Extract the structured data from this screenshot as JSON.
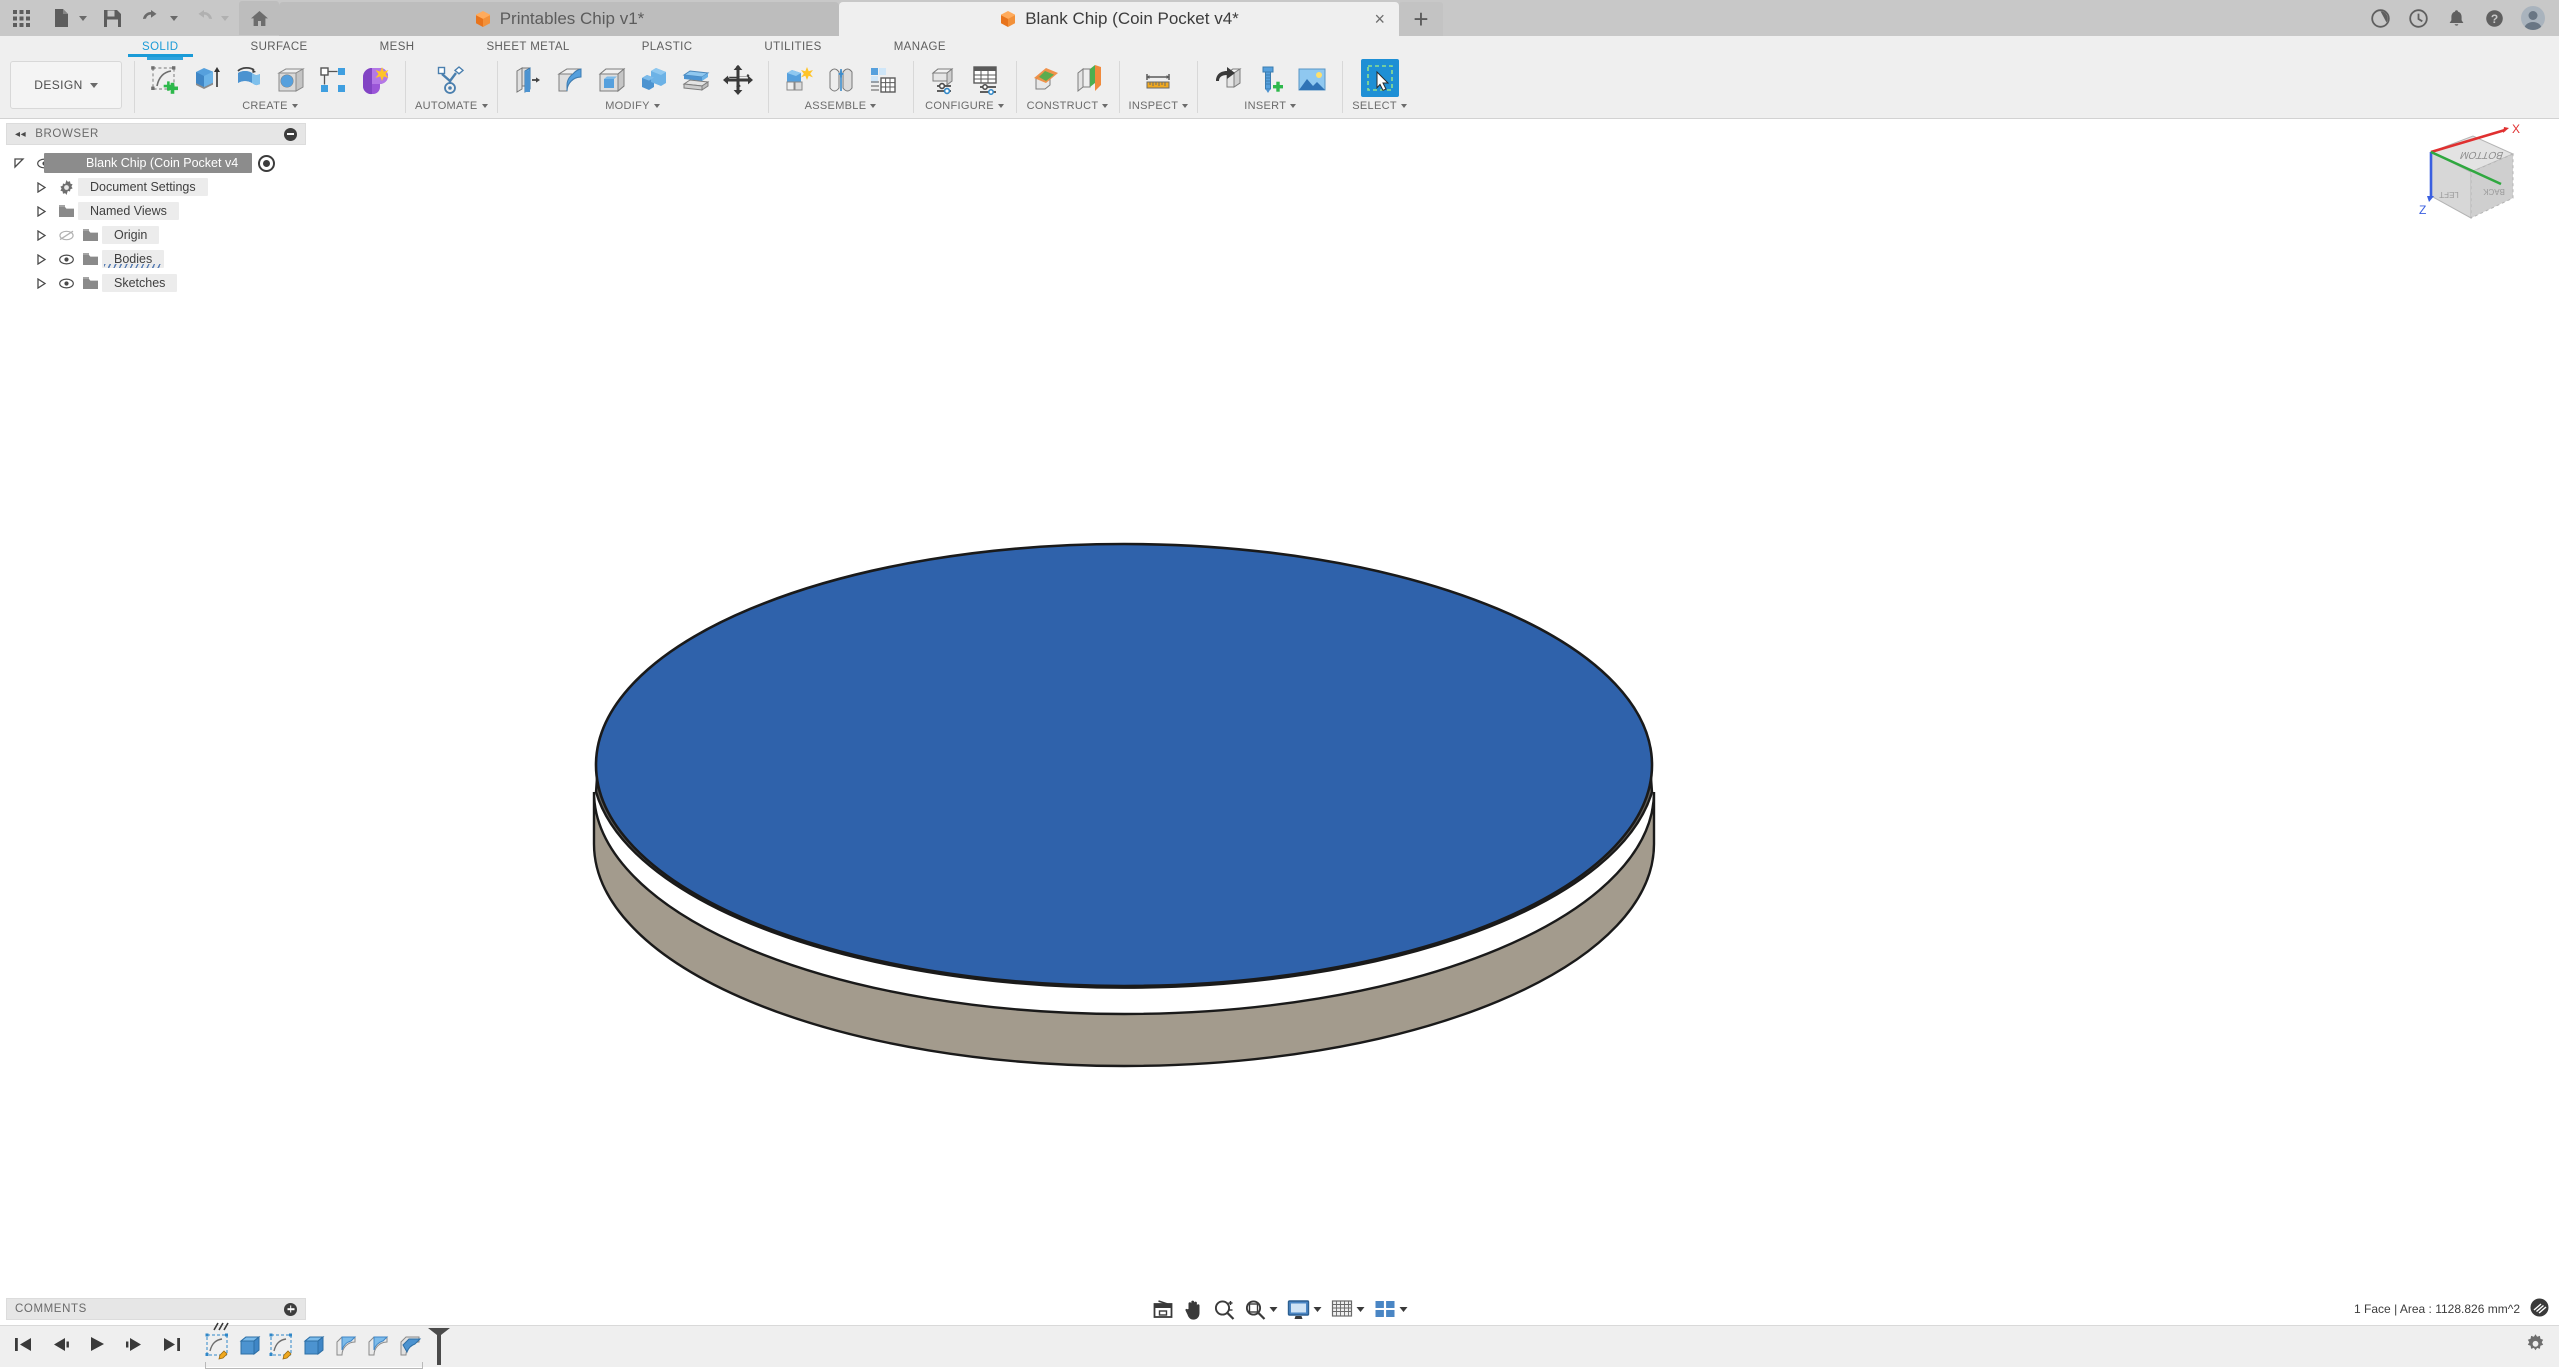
{
  "app": {
    "title_bar": {
      "quick_access": [
        {
          "name": "grid-apps-icon",
          "label": "Apps"
        },
        {
          "name": "new-document-icon",
          "label": "New"
        },
        {
          "name": "save-icon",
          "label": "Save"
        },
        {
          "name": "undo-icon",
          "label": "Undo"
        },
        {
          "name": "redo-icon",
          "label": "Redo"
        },
        {
          "name": "home-icon",
          "label": "Home"
        }
      ],
      "tabs": [
        {
          "label": "Printables Chip v1*",
          "active": false,
          "closable": false,
          "icon": "orange-cube-icon"
        },
        {
          "label": "Blank Chip (Coin Pocket v4*",
          "active": true,
          "closable": true,
          "icon": "orange-cube-icon"
        }
      ],
      "new_tab_label": "+",
      "close_glyph": "×",
      "system_icons": [
        {
          "name": "job-status-icon",
          "glyph": "◔"
        },
        {
          "name": "recent-activity-icon",
          "glyph": "◴"
        },
        {
          "name": "notifications-bell-icon",
          "glyph": "🔔"
        },
        {
          "name": "help-icon",
          "glyph": "?"
        },
        {
          "name": "user-avatar",
          "glyph": ""
        }
      ]
    },
    "ribbon_tabs": [
      {
        "label": "SOLID",
        "selected": true
      },
      {
        "label": "SURFACE",
        "selected": false
      },
      {
        "label": "MESH",
        "selected": false
      },
      {
        "label": "SHEET METAL",
        "selected": false
      },
      {
        "label": "PLASTIC",
        "selected": false
      },
      {
        "label": "UTILITIES",
        "selected": false
      },
      {
        "label": "MANAGE",
        "selected": false
      }
    ],
    "workspace_selector": {
      "label": "DESIGN"
    },
    "ribbon_groups": [
      {
        "label": "CREATE",
        "items": [
          {
            "name": "create-sketch-button",
            "label": "Create Sketch",
            "highlight": true
          },
          {
            "name": "extrude-button",
            "label": "Extrude"
          },
          {
            "name": "revolve-button",
            "label": "Revolve"
          },
          {
            "name": "hole-button",
            "label": "Hole"
          },
          {
            "name": "rectangular-pattern-button",
            "label": "Rectangular Pattern"
          },
          {
            "name": "form-button",
            "label": "Create Form"
          }
        ]
      },
      {
        "label": "AUTOMATE",
        "items": [
          {
            "name": "automate-button",
            "label": "Automated Modeling"
          }
        ]
      },
      {
        "label": "MODIFY",
        "items": [
          {
            "name": "press-pull-button",
            "label": "Press Pull"
          },
          {
            "name": "fillet-button",
            "label": "Fillet"
          },
          {
            "name": "shell-button",
            "label": "Shell"
          },
          {
            "name": "combine-button",
            "label": "Combine"
          },
          {
            "name": "split-face-button",
            "label": "Split Face"
          },
          {
            "name": "move-copy-button",
            "label": "Move/Copy"
          }
        ]
      },
      {
        "label": "ASSEMBLE",
        "items": [
          {
            "name": "new-component-button",
            "label": "New Component"
          },
          {
            "name": "joint-button",
            "label": "Joint"
          },
          {
            "name": "table-button",
            "label": "Motion Study"
          }
        ]
      },
      {
        "label": "CONFIGURE",
        "items": [
          {
            "name": "configuration-button",
            "label": "Configuration"
          },
          {
            "name": "configuration-table-button",
            "label": "Configuration Table"
          }
        ]
      },
      {
        "label": "CONSTRUCT",
        "items": [
          {
            "name": "offset-plane-button",
            "label": "Offset Plane"
          },
          {
            "name": "midplane-button",
            "label": "Midplane"
          }
        ]
      },
      {
        "label": "INSPECT",
        "items": [
          {
            "name": "measure-button",
            "label": "Measure"
          }
        ]
      },
      {
        "label": "INSERT",
        "items": [
          {
            "name": "insert-derive-button",
            "label": "Derive"
          },
          {
            "name": "insert-mcmaster-button",
            "label": "Insert McMaster-Carr Component"
          },
          {
            "name": "canvas-image-button",
            "label": "Canvas"
          }
        ]
      },
      {
        "label": "SELECT",
        "items": [
          {
            "name": "select-tool-button",
            "label": "Select",
            "active": true
          }
        ]
      }
    ]
  },
  "browser": {
    "title": "BROWSER",
    "collapse_glyph": "◂◂",
    "root": {
      "label": "Blank Chip (Coin Pocket v4",
      "visible": true,
      "selected": true
    },
    "items": [
      {
        "label": "Document Settings",
        "icon": "gear-icon",
        "eye": false
      },
      {
        "label": "Named Views",
        "icon": "folder-icon",
        "eye": false
      },
      {
        "label": "Origin",
        "icon": "folder-icon",
        "eye": true,
        "eye_off": true
      },
      {
        "label": "Bodies",
        "icon": "folder-icon",
        "eye": true,
        "eye_off": false,
        "underlined": true
      },
      {
        "label": "Sketches",
        "icon": "folder-icon",
        "eye": true,
        "eye_off": false
      }
    ]
  },
  "canvas": {
    "model": {
      "name": "coin-chip-body",
      "top_face_color": "#2f62ab",
      "top_face_selected": true,
      "chamfer_color": "#63605a",
      "side_wall_color": "#a39b8d",
      "outline_color": "#1a1a1a",
      "background": "#ffffff"
    },
    "view_cube": {
      "faces": [
        "BOTTOM",
        "LEFT",
        "BACK"
      ],
      "axis_x_color": "#e03030",
      "axis_y_color": "#2fa83f",
      "axis_z_color": "#3a5fe0",
      "axis_labels": [
        "X",
        "Z"
      ]
    }
  },
  "comments": {
    "title": "COMMENTS"
  },
  "nav_toolbar": [
    {
      "name": "orbit-home-icon",
      "label": "Home View"
    },
    {
      "name": "pan-hand-icon",
      "label": "Pan"
    },
    {
      "name": "zoom-magnifier-icon",
      "label": "Zoom"
    },
    {
      "name": "fit-view-icon",
      "label": "Fit",
      "caret": true
    },
    {
      "name": "display-settings-icon",
      "label": "Display Settings",
      "caret": true
    },
    {
      "name": "grid-snaps-icon",
      "label": "Grid and Snaps",
      "caret": true
    },
    {
      "name": "viewports-icon",
      "label": "Viewports",
      "caret": true
    }
  ],
  "status_bar": {
    "selection_info": "1 Face | Area : 1128.826 mm^2",
    "selection_filter_icon": "selection-filter-icon"
  },
  "timeline": {
    "playback": [
      {
        "name": "go-to-beginning-button",
        "glyph": "⏮"
      },
      {
        "name": "step-back-button",
        "glyph": "◀❙"
      },
      {
        "name": "play-button",
        "glyph": "▶"
      },
      {
        "name": "step-forward-button",
        "glyph": "❙▶"
      },
      {
        "name": "go-to-end-button",
        "glyph": "⏭"
      }
    ],
    "features": [
      {
        "name": "timeline-sketch-1",
        "type": "sketch",
        "marked": true
      },
      {
        "name": "timeline-extrude-1",
        "type": "extrude"
      },
      {
        "name": "timeline-sketch-2",
        "type": "sketch"
      },
      {
        "name": "timeline-extrude-2",
        "type": "extrude"
      },
      {
        "name": "timeline-fillet-1",
        "type": "fillet"
      },
      {
        "name": "timeline-fillet-2",
        "type": "fillet"
      },
      {
        "name": "timeline-fillet-3",
        "type": "fillet",
        "selected": true
      }
    ],
    "settings_icon": "timeline-settings-gear-icon"
  }
}
